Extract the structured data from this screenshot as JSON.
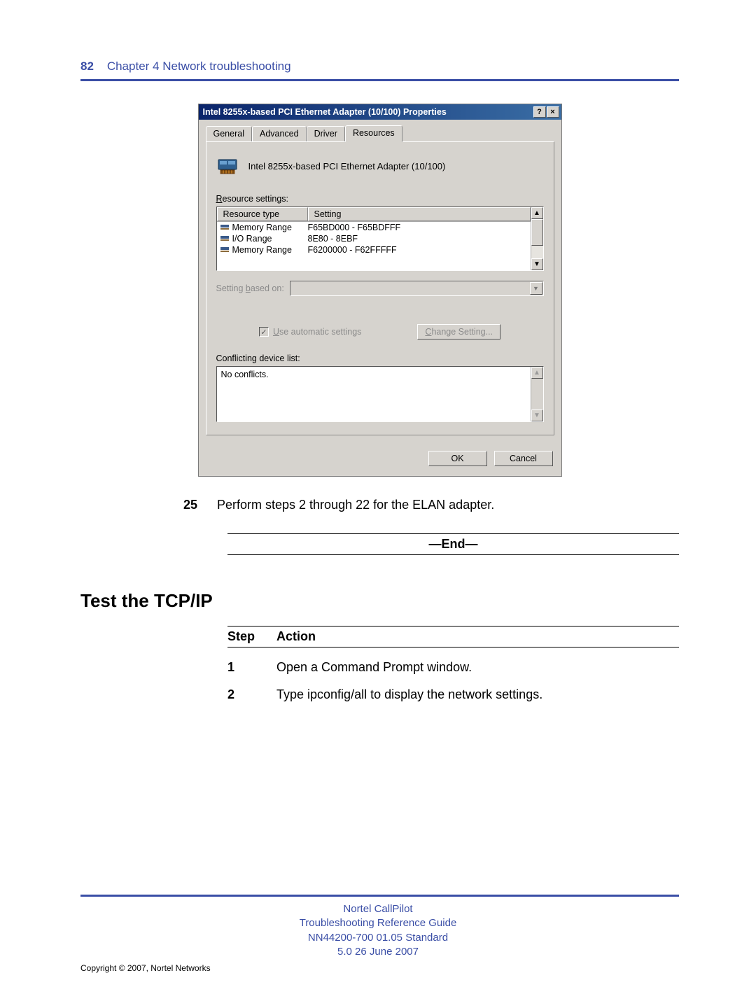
{
  "header": {
    "page_num": "82",
    "chapter": "Chapter 4  Network troubleshooting"
  },
  "dialog": {
    "title": "Intel 8255x-based PCI Ethernet Adapter (10/100) Properties",
    "help_btn": "?",
    "close_btn": "×",
    "tabs": {
      "general": "General",
      "advanced": "Advanced",
      "driver": "Driver",
      "resources": "Resources"
    },
    "device_name": "Intel 8255x-based PCI Ethernet Adapter (10/100)",
    "resource_settings_label_pre": "R",
    "resource_settings_label_post": "esource settings:",
    "list_header": {
      "col1": "Resource type",
      "col2": "Setting"
    },
    "resources": [
      {
        "type": "Memory Range",
        "value": "F65BD000 - F65BDFFF"
      },
      {
        "type": "I/O Range",
        "value": "8E80 - 8EBF"
      },
      {
        "type": "Memory Range",
        "value": "F6200000 - F62FFFFF"
      }
    ],
    "setting_based_label_pre": "Setting ",
    "setting_based_label_u": "b",
    "setting_based_label_post": "ased on:",
    "use_automatic_pre": "U",
    "use_automatic_post": "se automatic settings",
    "change_setting": "Change Setting...",
    "change_setting_ul": "C",
    "conflict_label": "Conflicting device list:",
    "conflict_text": "No conflicts.",
    "ok": "OK",
    "cancel": "Cancel"
  },
  "step25": {
    "num": "25",
    "text": "Perform steps 2 through 22 for the ELAN adapter."
  },
  "end": "—End—",
  "section_heading": "Test the TCP/IP",
  "action_table": {
    "head_step": "Step",
    "head_action": "Action",
    "rows": [
      {
        "n": "1",
        "t": "Open a Command Prompt window."
      },
      {
        "n": "2",
        "t": "Type ipconfig/all to display the network settings."
      }
    ]
  },
  "footer": {
    "line1": "Nortel CallPilot",
    "line2": "Troubleshooting Reference Guide",
    "line3": "NN44200-700   01.05   Standard",
    "line4": "5.0   26 June 2007",
    "copyright": "Copyright © 2007, Nortel Networks"
  }
}
